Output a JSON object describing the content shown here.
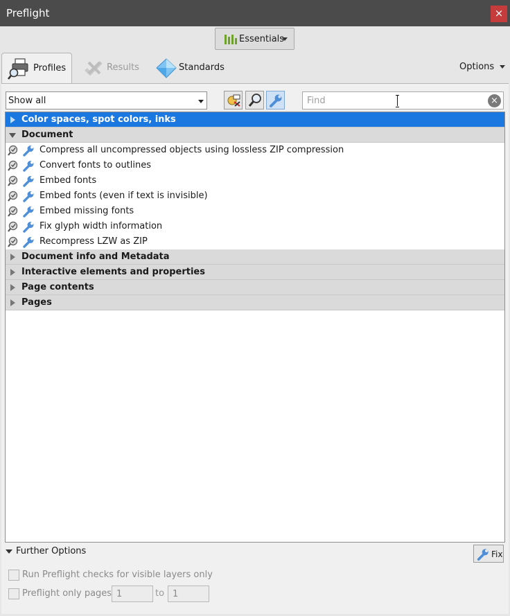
{
  "window": {
    "title": "Preflight",
    "close_label": "×"
  },
  "toolbar": {
    "essentials_label": "Essentials"
  },
  "tabs": [
    {
      "label": "Profiles",
      "icon": "profiles-printer-icon",
      "state": "active"
    },
    {
      "label": "Results",
      "icon": "results-icon",
      "state": "disabled"
    },
    {
      "label": "Standards",
      "icon": "standards-diamond-icon",
      "state": "normal"
    }
  ],
  "options_label": "Options",
  "filter": {
    "selected": "Show all"
  },
  "find": {
    "placeholder": "Find",
    "value": ""
  },
  "tree": {
    "categories": [
      {
        "label": "Color spaces, spot colors, inks",
        "expanded": false,
        "selected": true
      },
      {
        "label": "Document",
        "expanded": true,
        "selected": false,
        "items": [
          "Compress all uncompressed objects using lossless ZIP compression",
          "Convert fonts to outlines",
          "Embed fonts",
          "Embed fonts (even if text is invisible)",
          "Embed missing fonts",
          "Fix glyph width information",
          "Recompress LZW as ZIP"
        ]
      },
      {
        "label": "Document info and Metadata",
        "expanded": false,
        "selected": false
      },
      {
        "label": "Interactive elements and properties",
        "expanded": false,
        "selected": false
      },
      {
        "label": "Page contents",
        "expanded": false,
        "selected": false
      },
      {
        "label": "Pages",
        "expanded": false,
        "selected": false
      }
    ]
  },
  "further_options": {
    "label": "Further Options",
    "fix_label": "Fix",
    "visible_layers_label": "Run Preflight checks for visible layers only",
    "pages_label": "Preflight only pages",
    "from_page": "1",
    "to_label": "to",
    "to_page": "1"
  },
  "colors": {
    "titlebar": "#4b4b4b",
    "close": "#c63b3b",
    "selection": "#1a78e0",
    "fixup_wrench": "#4f8fd8"
  }
}
